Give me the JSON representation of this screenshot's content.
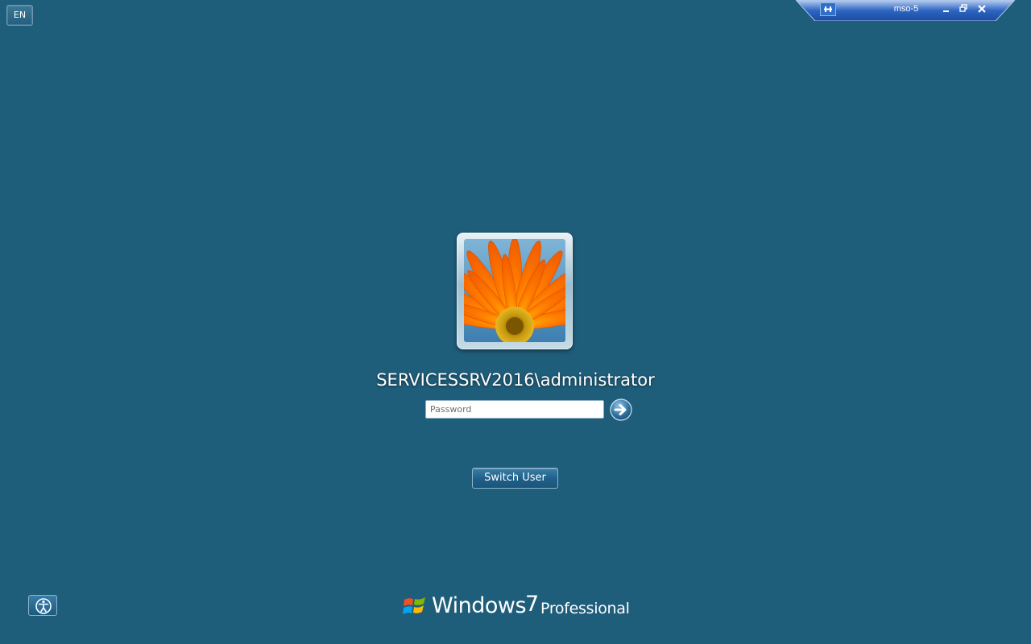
{
  "language": {
    "label": "EN"
  },
  "rdp_bar": {
    "title": "mso-5",
    "pin_icon": "pin-icon",
    "minimize_icon": "minimize-icon",
    "restore_icon": "restore-icon",
    "close_icon": "close-icon"
  },
  "user": {
    "name": "SERVICESSRV2016\\administrator",
    "tile_icon": "flower-user-picture"
  },
  "password": {
    "placeholder": "Password",
    "value": ""
  },
  "submit_icon": "arrow-right-icon",
  "switch_user": {
    "label": "Switch User"
  },
  "ease_of_access_icon": "ease-of-access-icon",
  "branding": {
    "windows": "Windows",
    "version": "7",
    "edition": "Professional"
  },
  "colors": {
    "background": "#1f5e7b",
    "accent": "#2f6fc8"
  }
}
